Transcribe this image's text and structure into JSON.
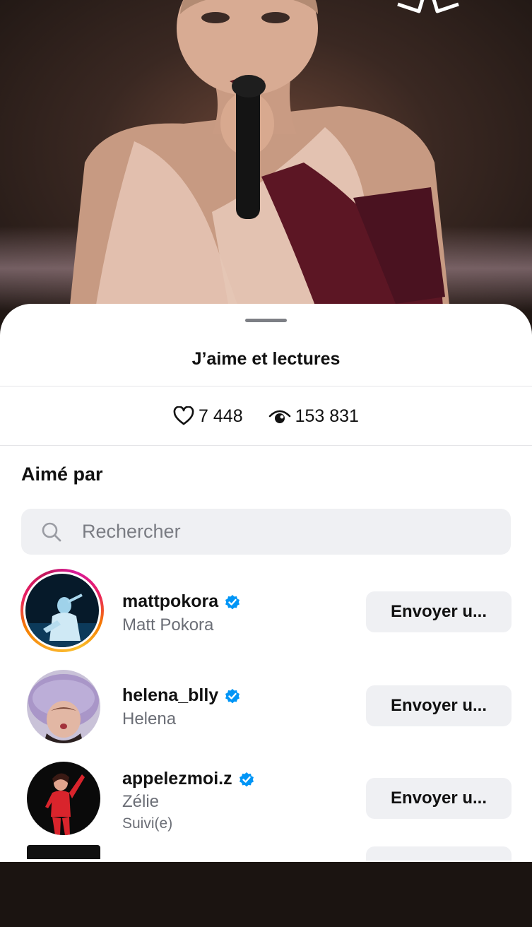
{
  "sheet": {
    "title": "J’aime et lectures",
    "likes": "7 448",
    "views": "153 831",
    "section_title": "Aimé par",
    "search_placeholder": "Rechercher"
  },
  "users": [
    {
      "username": "mattpokora",
      "fullname": "Matt Pokora",
      "action": "Envoyer u...",
      "verified": true,
      "story_ring": true
    },
    {
      "username": "helena_blly",
      "fullname": "Helena",
      "action": "Envoyer u...",
      "verified": true
    },
    {
      "username": "appelezmoi.z",
      "fullname": "Zélie",
      "subtext": "Suivi(e)",
      "action": "Envoyer u...",
      "verified": true
    }
  ],
  "icons": {
    "like": "heart-icon",
    "views": "eye-icon",
    "search": "search-icon",
    "verified": "verified-badge-icon",
    "favorite": "star-icon"
  },
  "colors": {
    "verified": "#0095f6",
    "button_bg": "#eff0f3",
    "secondary_text": "#6b6e76"
  }
}
